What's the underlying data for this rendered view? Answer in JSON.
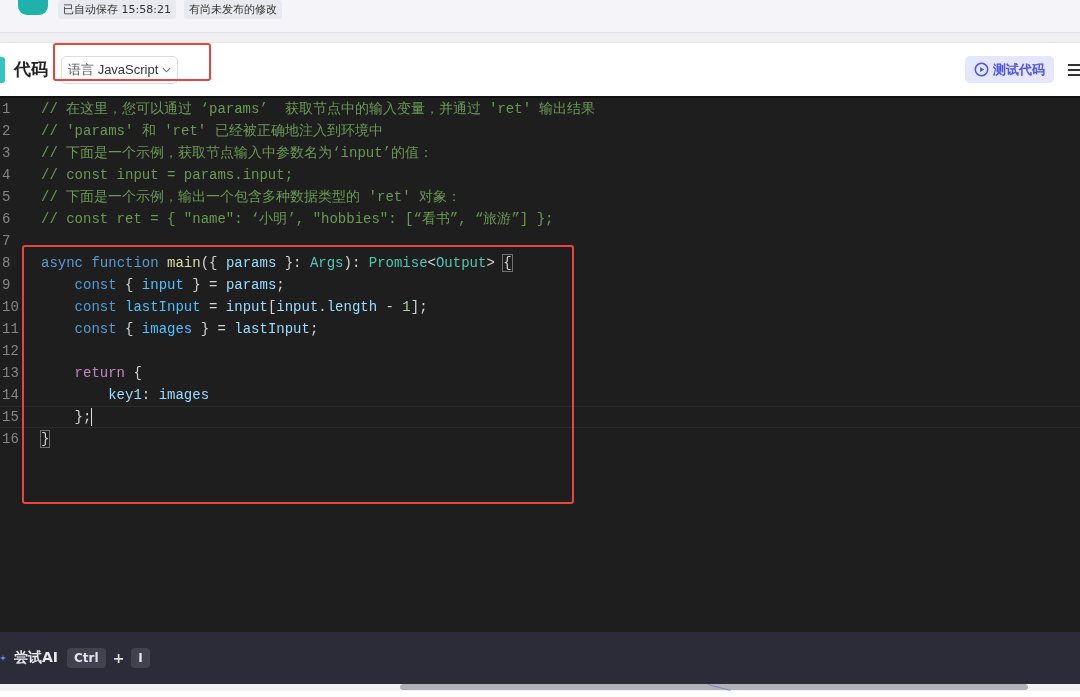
{
  "top_bar": {
    "badges": [
      "已自动保存 15:58:21",
      "有尚未发布的修改"
    ]
  },
  "header": {
    "title": "代码",
    "language_select": {
      "label": "语言",
      "value": "JavaScript",
      "outlined": true
    },
    "test_button": "测试代码"
  },
  "code": {
    "blocks": [
      {
        "lines": [
          {
            "number": "1",
            "tokens": [
              {
                "kind": "comment",
                "text": "// 在这里，您可以通过 ‘params’  获取节点中的输入变量，并通过 'ret' 输出结果"
              }
            ]
          },
          {
            "number": "2",
            "tokens": [
              {
                "kind": "comment",
                "text": "// 'params' 和 'ret' 已经被正确地注入到环境中"
              }
            ]
          },
          {
            "number": "3",
            "tokens": [
              {
                "kind": "comment",
                "text": "// 下面是一个示例，获取节点输入中参数名为‘input’的值："
              }
            ]
          },
          {
            "number": "4",
            "tokens": [
              {
                "kind": "comment",
                "text": "// const input = params.input;"
              }
            ]
          },
          {
            "number": "5",
            "tokens": [
              {
                "kind": "comment",
                "text": "// 下面是一个示例，输出一个包含多种数据类型的 'ret' 对象："
              }
            ]
          },
          {
            "number": "6",
            "tokens": [
              {
                "kind": "comment",
                "text": "// const ret = { \"name\": ‘小明’, \"hobbies\": [“看书”, “旅游”] };"
              }
            ]
          },
          {
            "number": "7"
          }
        ]
      },
      {
        "outlined": true,
        "lines": [
          {
            "number": "8",
            "tokens": [
              {
                "kind": "keyword",
                "text": "async "
              },
              {
                "kind": "keyword",
                "text": "function "
              },
              {
                "kind": "function",
                "text": "main"
              },
              {
                "kind": "plain",
                "text": "({ "
              },
              {
                "kind": "variable",
                "text": "params"
              },
              {
                "kind": "plain",
                "text": " }: "
              },
              {
                "kind": "type",
                "text": "Args"
              },
              {
                "kind": "plain",
                "text": "): "
              },
              {
                "kind": "type",
                "text": "Promise"
              },
              {
                "kind": "plain",
                "text": "<"
              },
              {
                "kind": "type",
                "text": "Output"
              },
              {
                "kind": "plain",
                "text": "> "
              },
              {
                "kind": "bracket",
                "text": "{"
              }
            ]
          },
          {
            "number": "9",
            "tokens": [
              {
                "kind": "keyword",
                "text": "    const"
              },
              {
                "kind": "plain",
                "text": " { "
              },
              {
                "kind": "constant",
                "text": "input"
              },
              {
                "kind": "plain",
                "text": " } = "
              },
              {
                "kind": "variable",
                "text": "params"
              },
              {
                "kind": "plain",
                "text": ";"
              }
            ]
          },
          {
            "number": "10",
            "tokens": [
              {
                "kind": "keyword",
                "text": "    const "
              },
              {
                "kind": "constant",
                "text": "lastInput"
              },
              {
                "kind": "plain",
                "text": " = "
              },
              {
                "kind": "variable",
                "text": "input"
              },
              {
                "kind": "plain",
                "text": "["
              },
              {
                "kind": "variable",
                "text": "input"
              },
              {
                "kind": "plain",
                "text": "."
              },
              {
                "kind": "variable",
                "text": "length"
              },
              {
                "kind": "plain",
                "text": " - "
              },
              {
                "kind": "number",
                "text": "1"
              },
              {
                "kind": "plain",
                "text": "];"
              }
            ]
          },
          {
            "number": "11",
            "tokens": [
              {
                "kind": "keyword",
                "text": "    const"
              },
              {
                "kind": "plain",
                "text": " { "
              },
              {
                "kind": "constant",
                "text": "images"
              },
              {
                "kind": "plain",
                "text": " } = "
              },
              {
                "kind": "variable",
                "text": "lastInput"
              },
              {
                "kind": "plain",
                "text": ";"
              }
            ]
          },
          {
            "number": "12"
          },
          {
            "number": "13",
            "tokens": [
              {
                "kind": "control",
                "text": "    return"
              },
              {
                "kind": "plain",
                "text": " {"
              }
            ]
          },
          {
            "number": "14",
            "tokens": [
              {
                "kind": "variable",
                "text": "        key1"
              },
              {
                "kind": "plain",
                "text": ": "
              },
              {
                "kind": "variable",
                "text": "images"
              }
            ]
          },
          {
            "number": "15",
            "current": true,
            "tokens": [
              {
                "kind": "plain",
                "text": "    };"
              }
            ]
          },
          {
            "number": "16",
            "tokens": [
              {
                "kind": "bracket",
                "text": "}"
              }
            ]
          }
        ]
      }
    ]
  },
  "ai_bar": {
    "label": "尝试AI",
    "keys": [
      "Ctrl",
      "I"
    ],
    "joiner": "+"
  }
}
